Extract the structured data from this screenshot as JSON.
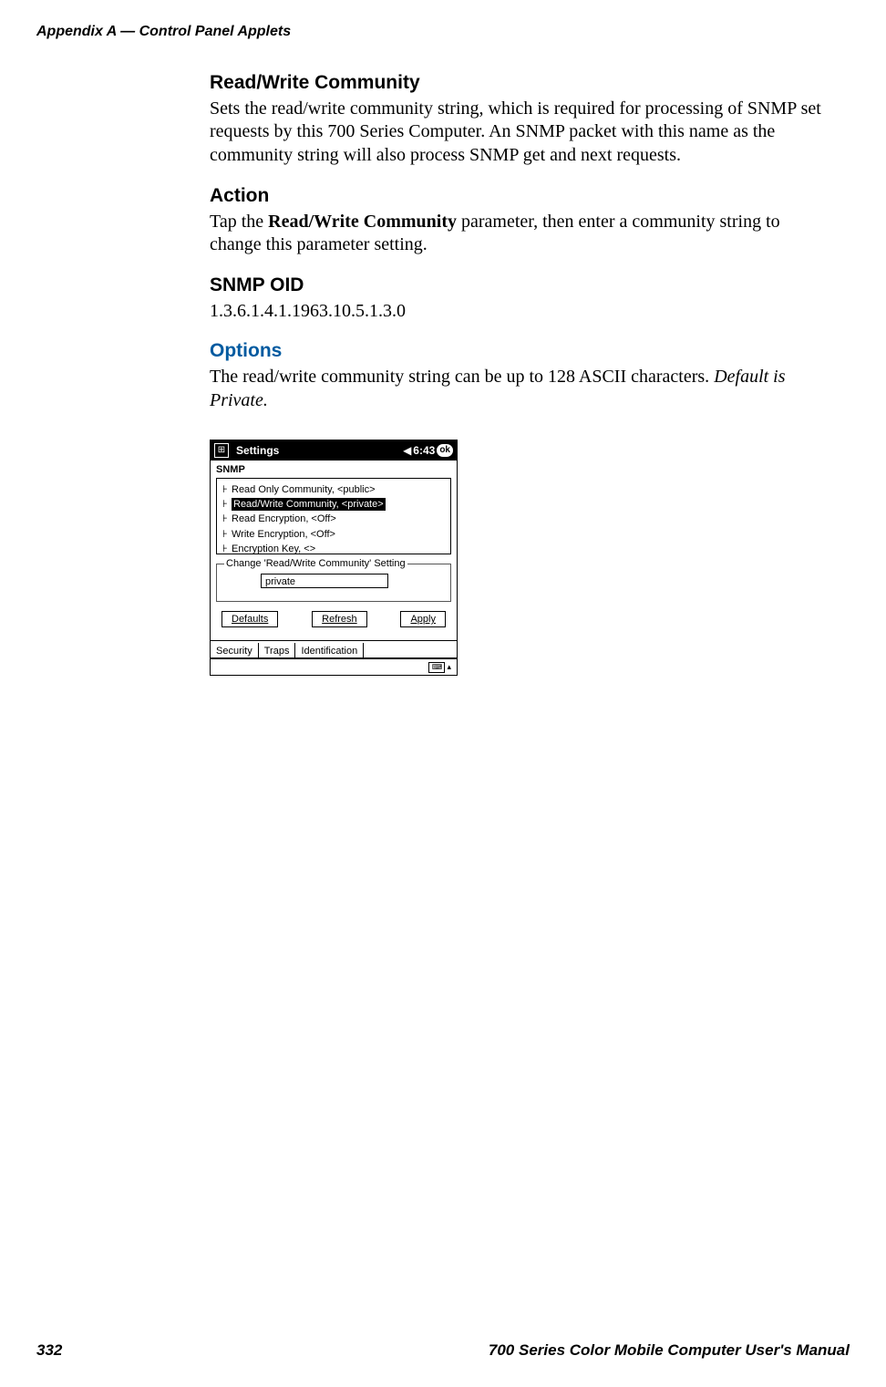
{
  "header": {
    "left": "Appendix A   —   Control Panel Applets"
  },
  "footer": {
    "page": "332",
    "right": "700 Series Color Mobile Computer User's Manual"
  },
  "sections": {
    "rw_title": "Read/Write Community",
    "rw_para": "Sets the read/write community string, which is required for processing of SNMP set requests by this 700 Series Computer. An SNMP packet with this name as the community string will also process SNMP get and next requests.",
    "action_title": "Action",
    "action_pre": "Tap the ",
    "action_bold": "Read/Write Community",
    "action_post": " parameter, then enter a community string to change this parameter setting.",
    "oid_title": "SNMP OID",
    "oid_value": "1.3.6.1.4.1.1963.10.5.1.3.0",
    "options_title": "Options",
    "options_pre": "The read/write community string can be up to 128 ASCII characters. ",
    "options_ital": "Default is Private."
  },
  "pda": {
    "win_icon": "⊞",
    "title": "Settings",
    "volume_icon": "◀",
    "time": "6:43",
    "ok_label": "ok",
    "panel_label": "SNMP",
    "tree": [
      "Read Only Community, <public>",
      "Read/Write Community, <private>",
      "Read Encryption, <Off>",
      "Write Encryption, <Off>",
      "Encryption Key, <>"
    ],
    "fieldset_legend": "Change 'Read/Write Community' Setting",
    "input_value": "private",
    "buttons": {
      "defaults": "Defaults",
      "refresh": "Refresh",
      "apply": "Apply"
    },
    "tabs": {
      "security": "Security",
      "traps": "Traps",
      "identification": "Identification"
    },
    "keyboard_glyph": "⌨",
    "up_arrow": "▴"
  }
}
